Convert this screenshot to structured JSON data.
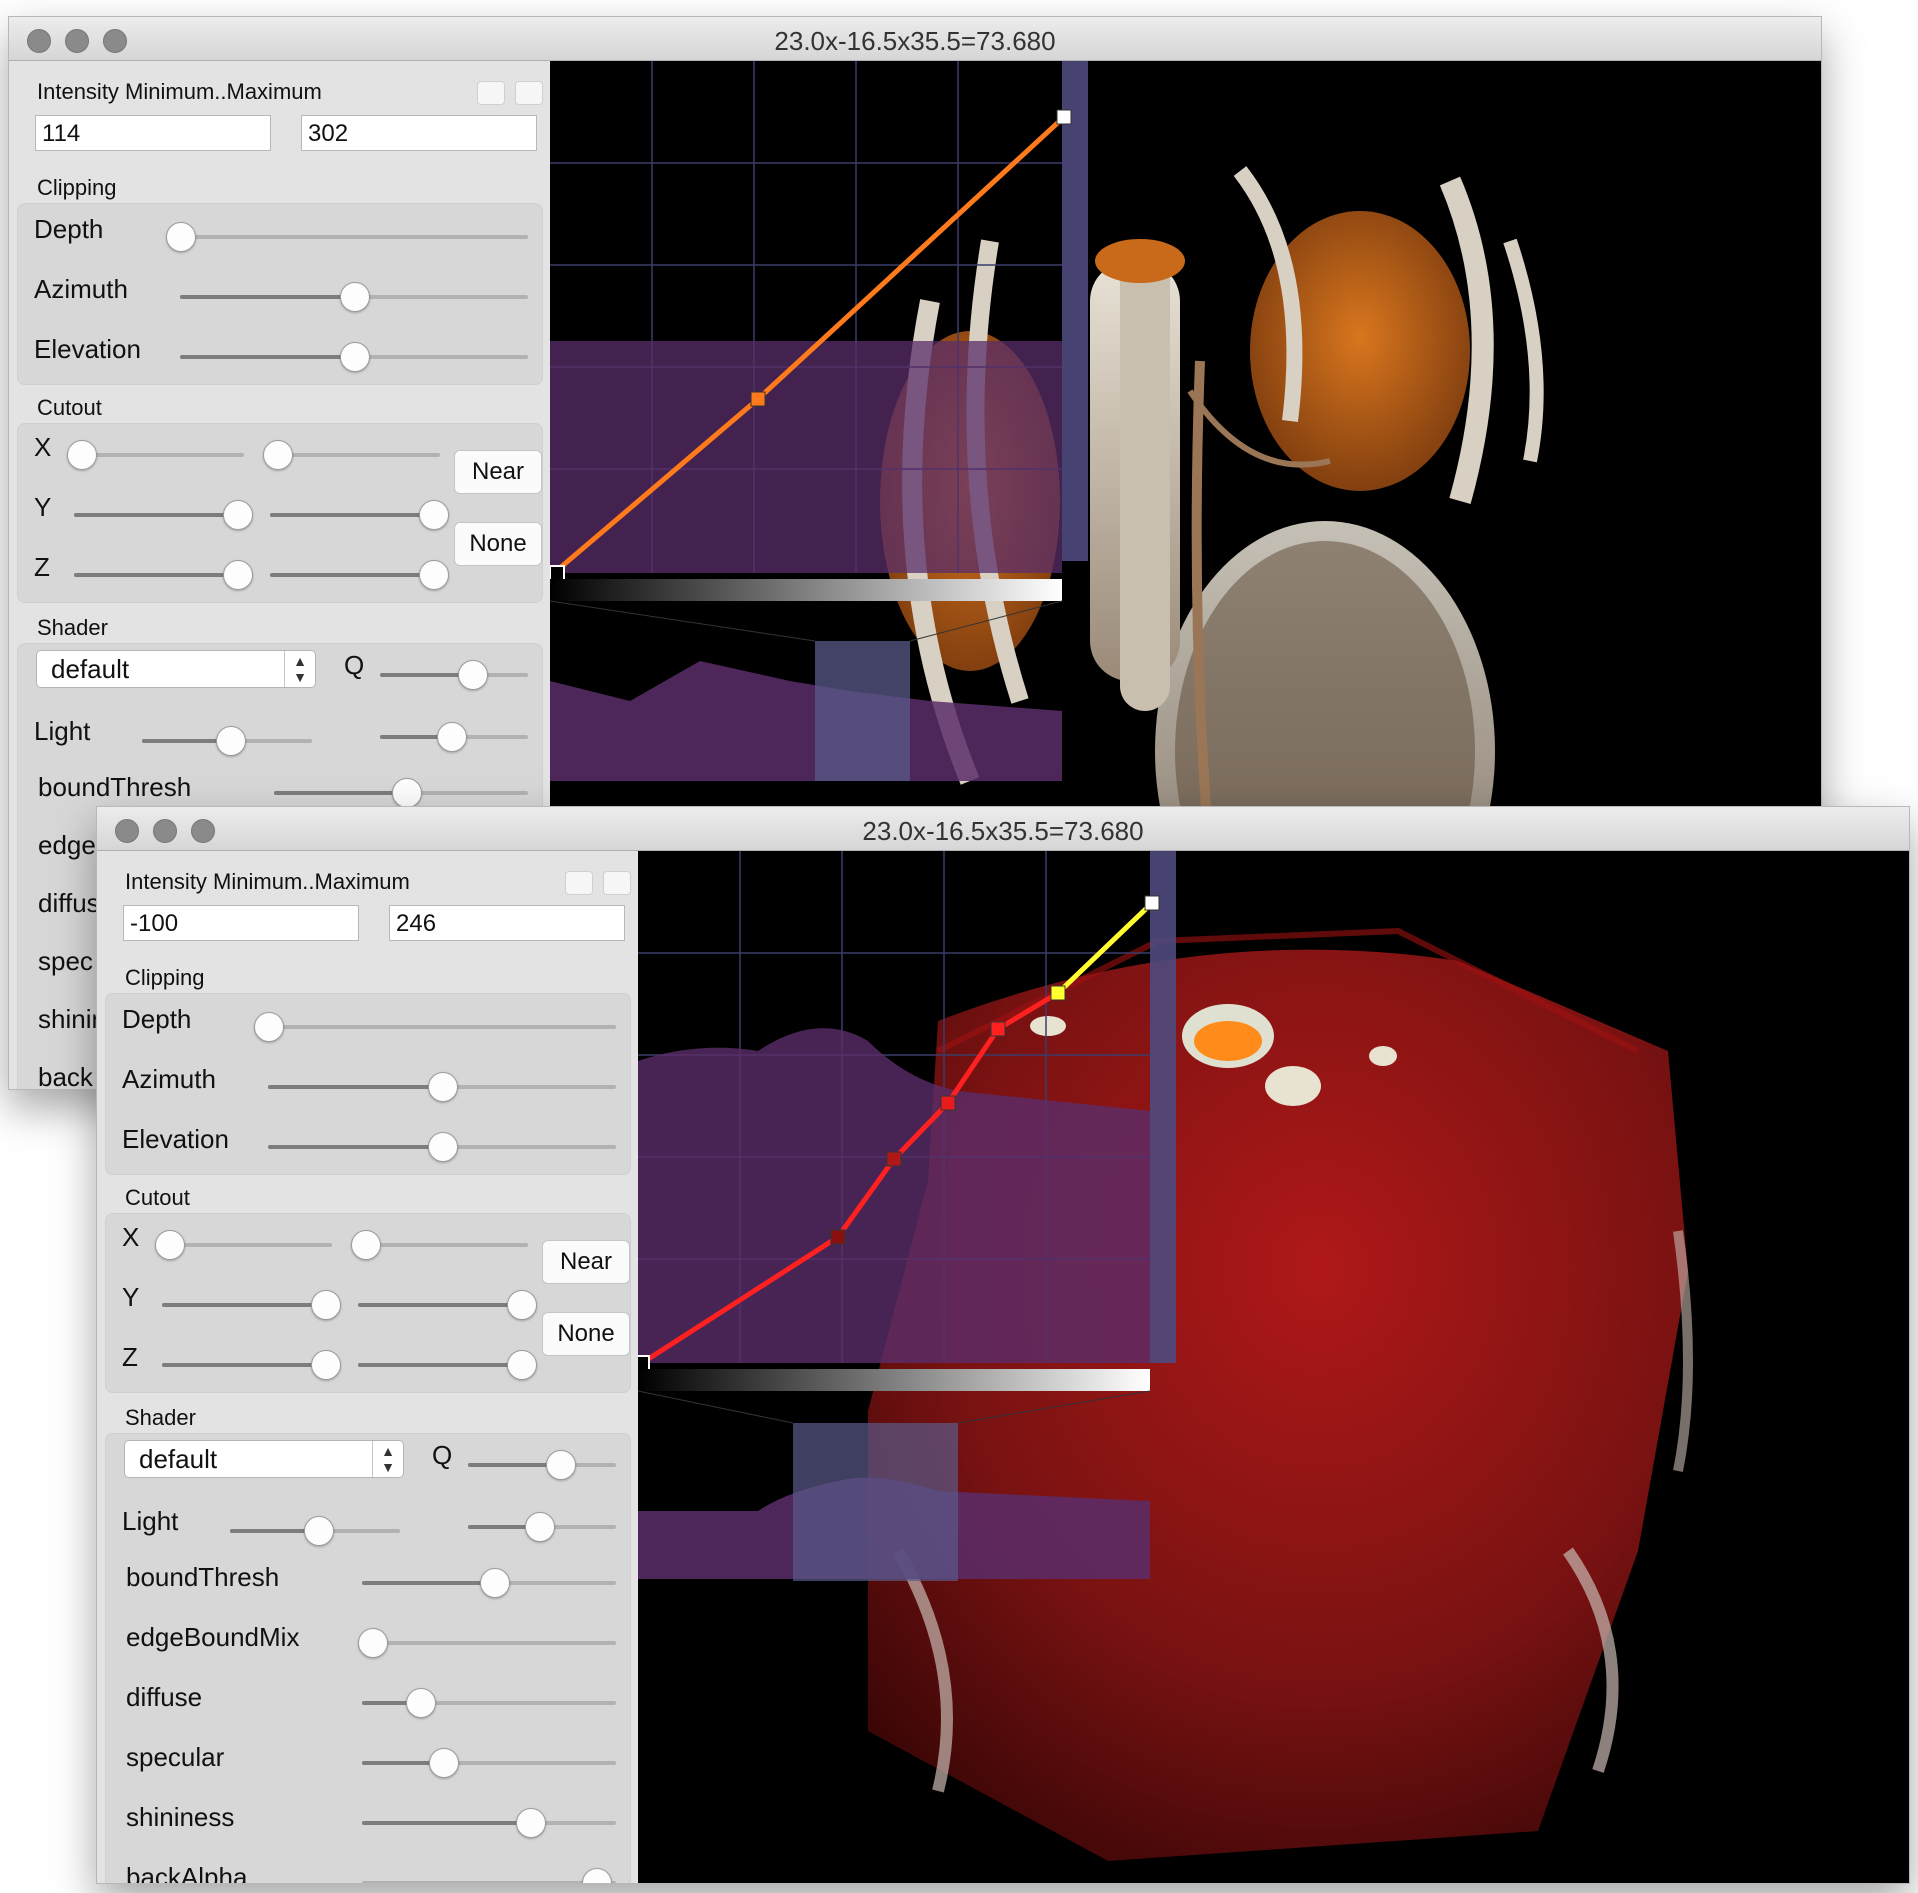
{
  "windows": [
    {
      "title": "23.0x-16.5x35.5=73.680",
      "intensity": {
        "label": "Intensity Minimum..Maximum",
        "min": "114",
        "max": "302"
      },
      "clipping": {
        "label": "Clipping",
        "depth": "Depth",
        "azimuth": "Azimuth",
        "elevation": "Elevation",
        "depth_level": 0.0,
        "azimuth_level": 0.5,
        "elevation_level": 0.5
      },
      "cutout": {
        "label": "Cutout",
        "x": "X",
        "y": "Y",
        "z": "Z",
        "near": "Near",
        "none": "None"
      },
      "shader": {
        "label": "Shader",
        "selected": "default",
        "q": "Q",
        "light": "Light",
        "params": [
          "boundThresh",
          "edge",
          "diffus",
          "spec",
          "shinir",
          "back"
        ]
      }
    },
    {
      "title": "23.0x-16.5x35.5=73.680",
      "intensity": {
        "label": "Intensity Minimum..Maximum",
        "min": "-100",
        "max": "246"
      },
      "clipping": {
        "label": "Clipping",
        "depth": "Depth",
        "azimuth": "Azimuth",
        "elevation": "Elevation",
        "depth_level": 0.0,
        "azimuth_level": 0.5,
        "elevation_level": 0.5
      },
      "cutout": {
        "label": "Cutout",
        "x": "X",
        "y": "Y",
        "z": "Z",
        "near": "Near",
        "none": "None"
      },
      "shader": {
        "label": "Shader",
        "selected": "default",
        "q": "Q",
        "light": "Light",
        "params": [
          "boundThresh",
          "edgeBoundMix",
          "diffuse",
          "specular",
          "shininess",
          "backAlpha"
        ]
      }
    }
  ],
  "icons": [
    "close-dot-icon",
    "minimize-dot-icon",
    "zoom-dot-icon",
    "stepper-arrows-icon"
  ],
  "colors": {
    "histogram": "#5a2d6a",
    "tf_orange": "#ff7a1a",
    "tf_red": "#ff2020",
    "tf_yellow": "#ffff30",
    "volume_red": "#7a1212"
  }
}
